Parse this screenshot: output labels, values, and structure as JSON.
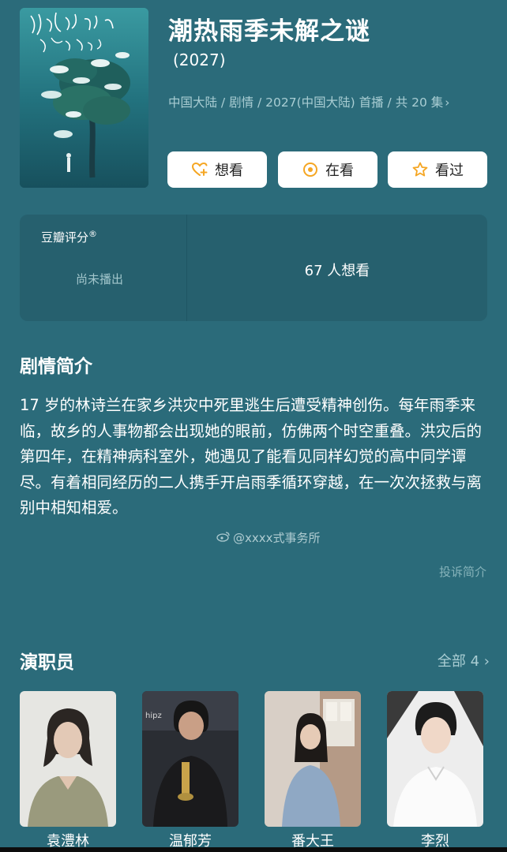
{
  "show": {
    "title": "潮热雨季未解之谜",
    "year": "(2027)",
    "meta": "中国大陆 / 剧情 / 2027(中国大陆) 首播 / 共 20 集",
    "meta_chevron": "›",
    "poster_calligraphy": "潮热雨季未解之谜"
  },
  "actions": {
    "want_label": "想看",
    "watching_label": "在看",
    "watched_label": "看过",
    "want_icon": "heart-plus-icon",
    "watching_icon": "target-icon",
    "watched_icon": "star-icon",
    "icon_color": "#f5a623"
  },
  "rating": {
    "label": "豆瓣评分",
    "registered_mark": "®",
    "status": "尚未播出",
    "want_count_text": "67 人想看"
  },
  "synopsis": {
    "heading": "剧情简介",
    "text": "17 岁的林诗兰在家乡洪灾中死里逃生后遭受精神创伤。每年雨季来临，故乡的人事物都会出现她的眼前，仿佛两个时空重叠。洪灾后的第四年，在精神病科室外，她遇见了能看见同样幻觉的高中同学谭尽。有着相同经历的二人携手开启雨季循环穿越，在一次次拯救与离别中相知相爱。",
    "report_label": "投诉简介"
  },
  "cast": {
    "heading": "演职员",
    "all_label": "全部 4",
    "all_chevron": "›",
    "members": [
      {
        "name": "袁澧林"
      },
      {
        "name": "温郁芳"
      },
      {
        "name": "番大王"
      },
      {
        "name": "李烈"
      }
    ]
  },
  "watermark": {
    "text": "@xxxx式事务所"
  },
  "colors": {
    "background": "#2b6b7a",
    "card": "#26606e",
    "muted_text": "#a9cdd3",
    "button_bg": "#ffffff"
  }
}
